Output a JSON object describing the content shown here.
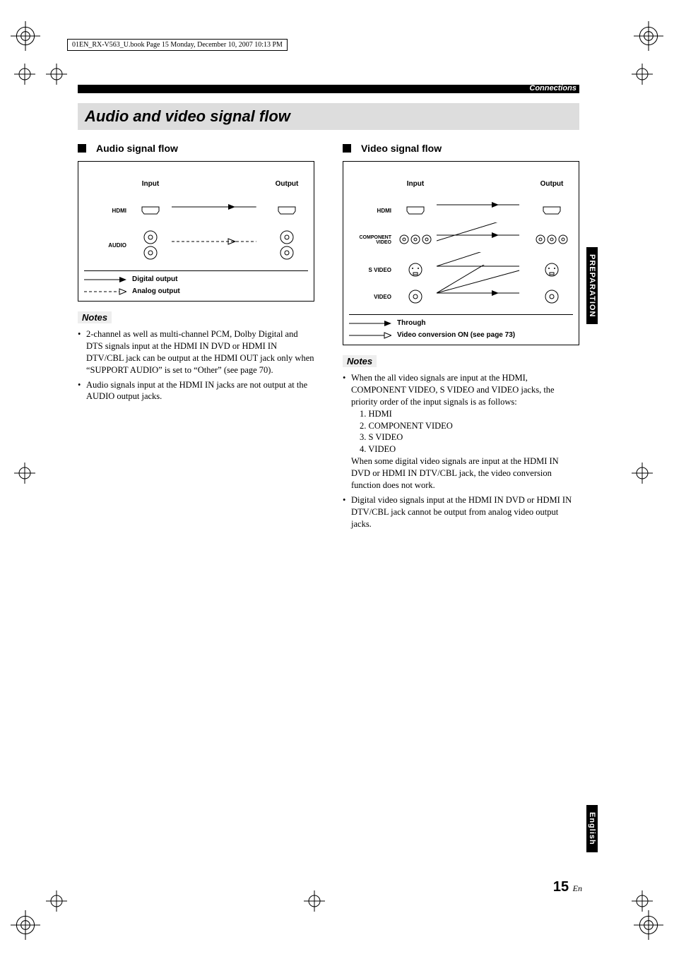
{
  "print_header": "01EN_RX-V563_U.book  Page 15  Monday, December 10, 2007  10:13 PM",
  "header_label": "Connections",
  "section_title": "Audio and video signal flow",
  "side_tab_1": "PREPARATION",
  "side_tab_2": "English",
  "page_number": "15",
  "page_suffix": "En",
  "audio": {
    "heading": "Audio signal flow",
    "col_in": "Input",
    "col_out": "Output",
    "rows": {
      "hdmi": "HDMI",
      "audio": "AUDIO"
    },
    "legend1": "Digital output",
    "legend2": "Analog output",
    "notes_label": "Notes",
    "notes": [
      "2-channel as well as multi-channel PCM, Dolby Digital and DTS signals input at the HDMI IN DVD or HDMI IN DTV/CBL jack can be output at the HDMI OUT jack only when “SUPPORT AUDIO” is set to “Other” (see page 70).",
      "Audio signals input at the HDMI IN jacks are not output at the AUDIO output jacks."
    ]
  },
  "video": {
    "heading": "Video signal flow",
    "col_in": "Input",
    "col_out": "Output",
    "rows": {
      "hdmi": "HDMI",
      "component": "COMPONENT VIDEO",
      "svideo": "S VIDEO",
      "video": "VIDEO"
    },
    "legend1": "Through",
    "legend2": "Video conversion ON (see page 73)",
    "notes_label": "Notes",
    "note1_intro": "When the all video signals are input at the HDMI, COMPONENT VIDEO, S VIDEO and VIDEO jacks, the priority order of the input signals is as follows:",
    "priority": [
      "1. HDMI",
      "2. COMPONENT VIDEO",
      "3. S VIDEO",
      "4. VIDEO"
    ],
    "note1_tail": "When some digital video signals are input at the HDMI IN DVD or HDMI IN DTV/CBL jack, the video conversion function does not work.",
    "note2": "Digital video signals input at the HDMI IN DVD or HDMI IN DTV/CBL jack cannot be output from analog video output jacks."
  }
}
